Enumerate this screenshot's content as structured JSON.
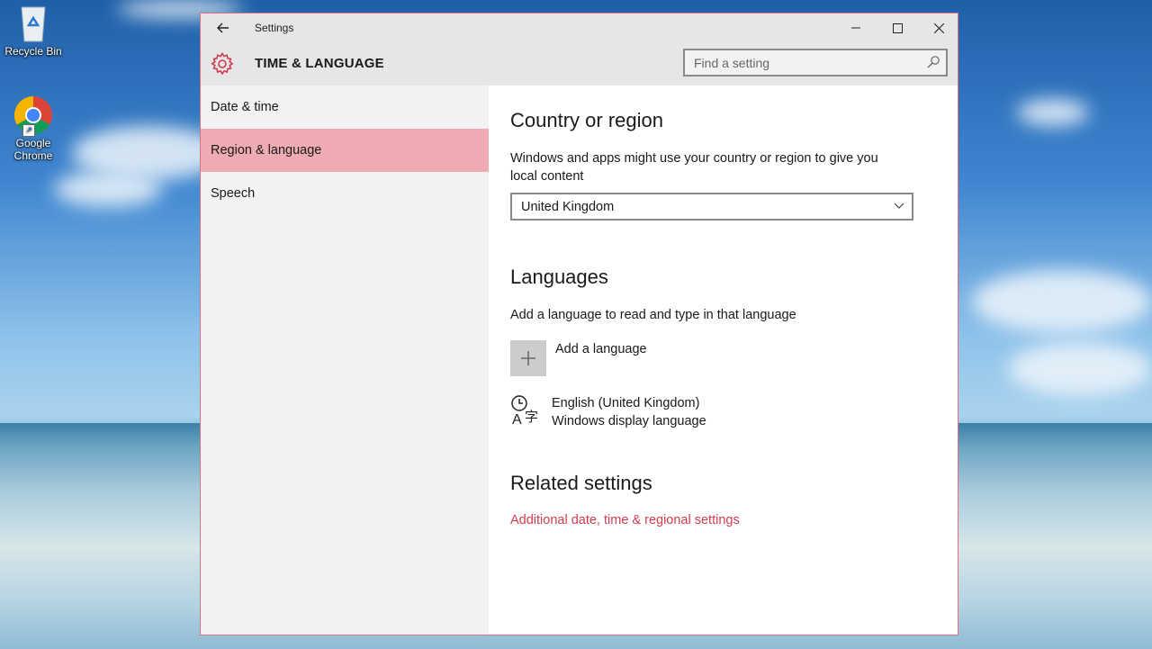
{
  "desktop": {
    "recycle_bin_label": "Recycle Bin",
    "chrome_label_line1": "Google",
    "chrome_label_line2": "Chrome"
  },
  "window": {
    "title": "Settings",
    "section_title": "TIME & LANGUAGE",
    "accent_color": "#d13c4f"
  },
  "search": {
    "placeholder": "Find a setting"
  },
  "sidebar": {
    "items": [
      {
        "label": "Date & time"
      },
      {
        "label": "Region & language",
        "selected": true
      },
      {
        "label": "Speech"
      }
    ]
  },
  "country": {
    "heading": "Country or region",
    "description": "Windows and apps might use your country or region to give you local content",
    "selected": "United Kingdom"
  },
  "languages": {
    "heading": "Languages",
    "description": "Add a language to read and type in that language",
    "add_label": "Add a language",
    "items": [
      {
        "name": "English (United Kingdom)",
        "subtitle": "Windows display language"
      }
    ]
  },
  "related": {
    "heading": "Related settings",
    "link": "Additional date, time & regional settings"
  }
}
